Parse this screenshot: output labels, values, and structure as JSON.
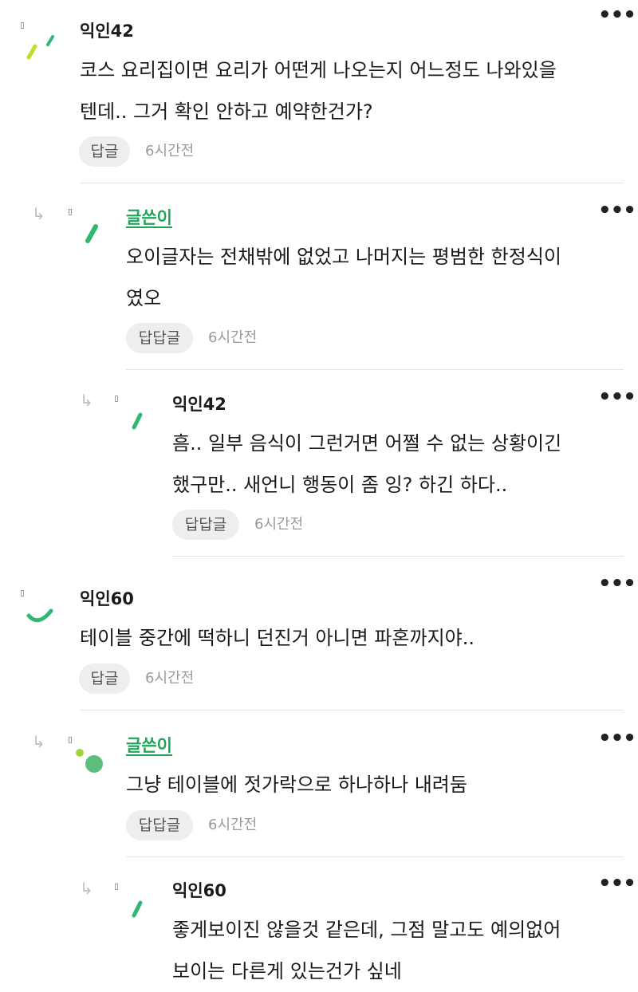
{
  "comments": [
    {
      "name": "익인42",
      "lines": [
        "코스 요리집이면 요리가 어떤게 나오는지 어느정도 나와있을",
        "텐데.. 그거 확인 안하고 예약한건가?"
      ],
      "reply_label": "답글",
      "time": "6시간전"
    },
    {
      "name": "글쓴이",
      "lines": [
        "오이글자는 전채밖에 없었고 나머지는 평범한 한정식이",
        "였오"
      ],
      "reply_label": "답답글",
      "time": "6시간전"
    },
    {
      "name": "익인42",
      "lines": [
        "흠.. 일부 음식이 그런거면 어쩔 수 없는 상황이긴",
        "했구만.. 새언니 행동이 좀 잉? 하긴 하다.."
      ],
      "reply_label": "답답글",
      "time": "6시간전"
    },
    {
      "name": "익인60",
      "lines": [
        "테이블 중간에 떡하니 던진거 아니면 파혼까지야.."
      ],
      "reply_label": "답글",
      "time": "6시간전"
    },
    {
      "name": "글쓴이",
      "lines": [
        "그냥 테이블에 젓가락으로 하나하나 내려둠"
      ],
      "reply_label": "답답글",
      "time": "6시간전"
    },
    {
      "name": "익인60",
      "lines": [
        "좋게보이진 않을것 같은데, 그점 말고도 예의없어",
        "보이는 다른게 있는건가 싶네"
      ],
      "reply_label": "",
      "time": ""
    }
  ],
  "icons": {
    "reply_arrow": "reply-arrow-icon",
    "more": "more-options-icon"
  },
  "colors": {
    "author_name": "#1fa458",
    "avatar_green": "#2eb872",
    "avatar_lime": "#c6dc2a",
    "reply_bg": "#eeeeee"
  }
}
